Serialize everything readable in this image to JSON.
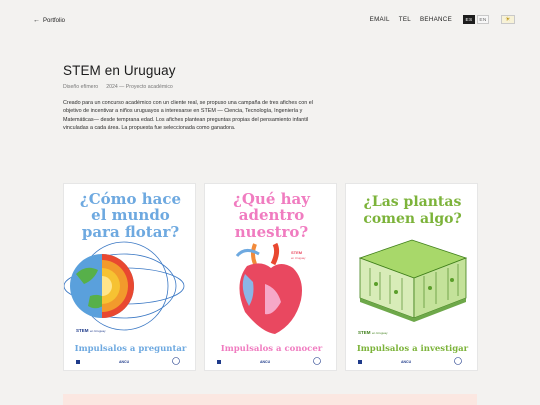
{
  "topbar": {
    "back_label": "Portfolio",
    "nav_links": [
      "EMAIL",
      "TEL",
      "BEHANCE"
    ],
    "lang_options": [
      "ES",
      "EN"
    ],
    "active_lang": "ES",
    "theme_icon": "sun-icon"
  },
  "project": {
    "title": "STEM en Uruguay",
    "category": "Diseño efímero",
    "year_info": "2024 — Proyecto académico",
    "description": "Creado para un concurso académico con un cliente real, se propuso una campaña de tres afiches con el objetivo de incentivar a niños uruguayos a interesarse en STEM — Ciencia, Tecnología, Ingeniería y Matemáticas— desde temprana edad. Los afiches plantean preguntas propias del pensamiento infantil vinculadas a cada área. La propuesta fue seleccionada como ganadora."
  },
  "posters": [
    {
      "title_lines": [
        "¿Cómo hace",
        "el mundo",
        "para flotar?"
      ],
      "brand": "STEM",
      "brand_sub": "en Uruguay",
      "tagline": "Impulsalos a preguntar",
      "title_color": "#6ea9e0",
      "tagline_color": "#6ea9e0",
      "illustration": "earth-layers"
    },
    {
      "title_lines": [
        "¿Qué hay",
        "adentro",
        "nuestro?"
      ],
      "brand": "STEM",
      "brand_sub": "en Uruguay",
      "tagline": "Impulsalos a conocer",
      "title_color": "#f07cc0",
      "tagline_color": "#f07cc0",
      "illustration": "heart"
    },
    {
      "title_lines": [
        "¿Las plantas",
        "comen algo?"
      ],
      "brand": "STEM",
      "brand_sub": "en Uruguay",
      "tagline": "Impulsalos a investigar",
      "title_color": "#7cb33a",
      "tagline_color": "#7cb33a",
      "illustration": "leaf-cells"
    }
  ],
  "poster_footer": {
    "org1": "ANCU",
    "org1_sub": "Uruguay"
  }
}
